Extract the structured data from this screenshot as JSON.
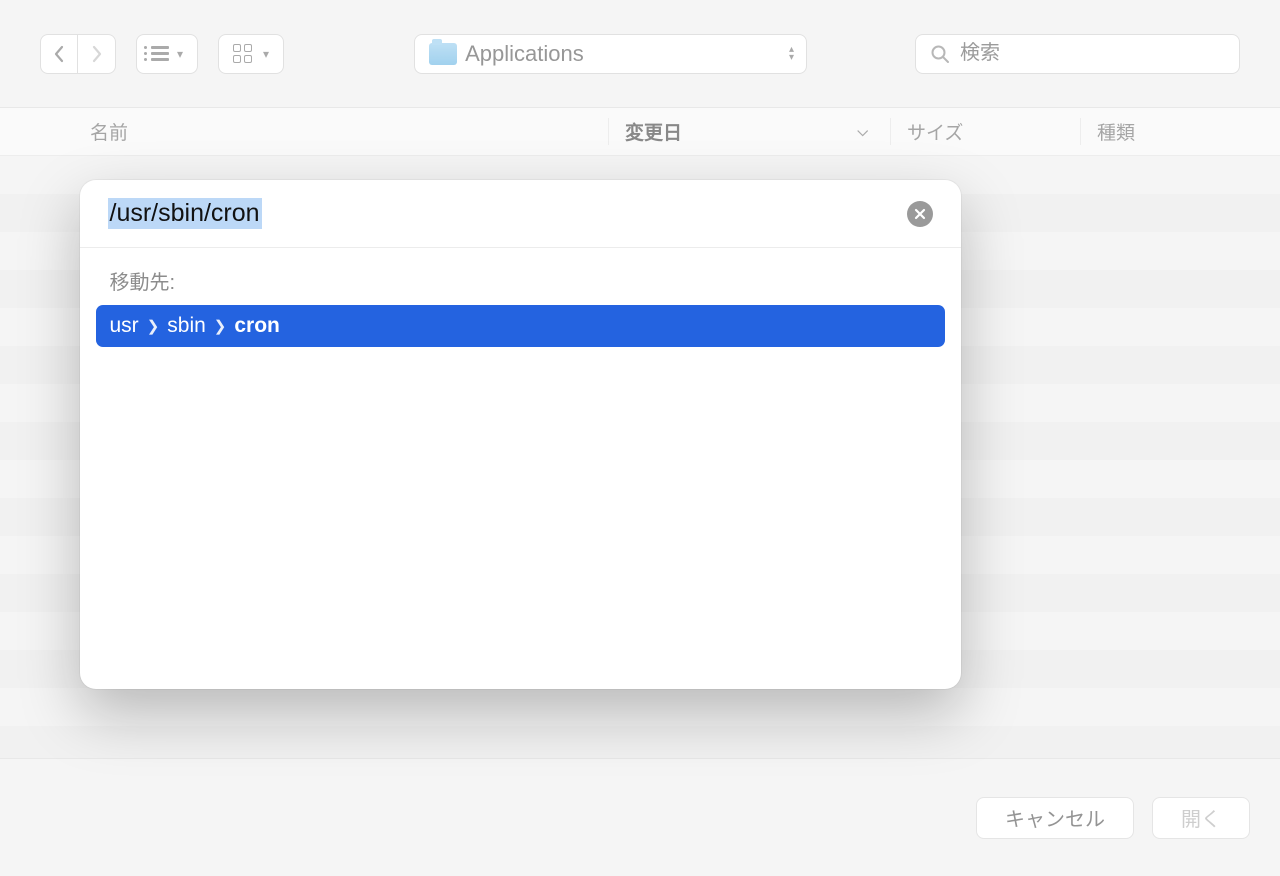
{
  "toolbar": {
    "location_label": "Applications",
    "search_placeholder": "検索"
  },
  "columns": {
    "name": "名前",
    "date": "変更日",
    "size": "サイズ",
    "kind": "種類"
  },
  "footer": {
    "cancel": "キャンセル",
    "open": "開く"
  },
  "sheet": {
    "input_value": "/usr/sbin/cron",
    "goto_label": "移動先:",
    "path": [
      "usr",
      "sbin",
      "cron"
    ]
  }
}
